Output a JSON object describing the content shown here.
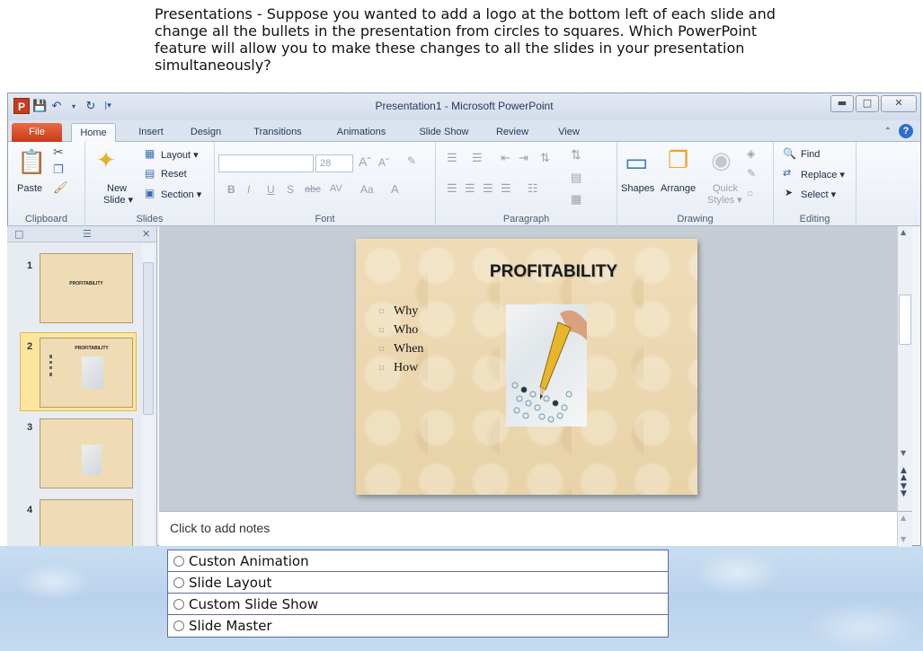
{
  "question": "Presentations - Suppose you wanted to add a logo at the bottom left of each slide and change all the bullets in the presentation from circles to squares. Which PowerPoint feature will allow you to make these changes to all the slides in your presentation simultaneously?",
  "window": {
    "title": "Presentation1 - Microsoft PowerPoint",
    "controls": [
      "minimize",
      "maximize",
      "close"
    ]
  },
  "tabs": [
    "File",
    "Home",
    "Insert",
    "Design",
    "Transitions",
    "Animations",
    "Slide Show",
    "Review",
    "View"
  ],
  "active_tab": "Home",
  "ribbon": {
    "clipboard": {
      "label": "Clipboard",
      "paste": "Paste"
    },
    "slides": {
      "label": "Slides",
      "new_slide": "New Slide",
      "new_slide_line1": "New",
      "new_slide_line2": "Slide ▾",
      "layout": "Layout ▾",
      "reset": "Reset",
      "section": "Section ▾"
    },
    "font": {
      "label": "Font",
      "size": "28",
      "bold": "B",
      "italic": "I",
      "underline": "U",
      "shadow": "S",
      "strike": "abc",
      "spacing": "AV",
      "case": "Aa",
      "color": "A"
    },
    "paragraph": {
      "label": "Paragraph"
    },
    "drawing": {
      "label": "Drawing",
      "shapes": "Shapes",
      "arrange": "Arrange",
      "quick_styles": "Quick Styles",
      "quick_line1": "Quick",
      "quick_line2": "Styles ▾"
    },
    "editing": {
      "label": "Editing",
      "find": "Find",
      "replace": "Replace ▾",
      "select": "Select ▾"
    }
  },
  "slides_pane": {
    "thumbnails": [
      {
        "number": "1",
        "title": "PROFITABILITY"
      },
      {
        "number": "2",
        "title": "PROFITABILITY",
        "selected": true
      },
      {
        "number": "3",
        "title": ""
      },
      {
        "number": "4",
        "title": ""
      }
    ]
  },
  "slide": {
    "title": "PROFITABILITY",
    "bullets": [
      "Why",
      "Who",
      "When",
      "How"
    ]
  },
  "notes_placeholder": "Click to add notes",
  "options": [
    "Custon Animation",
    "Slide Layout",
    "Custom Slide Show",
    "Slide Master"
  ]
}
